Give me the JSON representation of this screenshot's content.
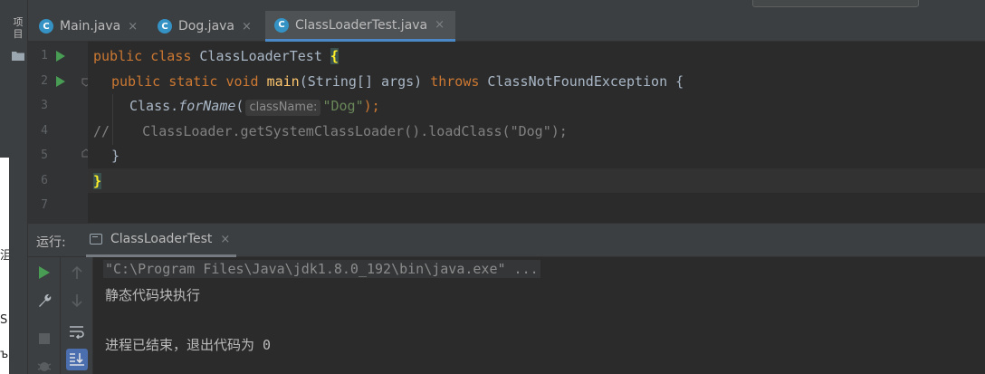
{
  "outside_glyphs": [
    "沮",
    "S",
    "铭",
    "ъ"
  ],
  "sidebar": {
    "project_label": "项目",
    "folder_icon": "folder-icon"
  },
  "tabs": [
    {
      "label": "Main.java",
      "icon": "C",
      "close": "×"
    },
    {
      "label": "Dog.java",
      "icon": "C",
      "close": "×"
    },
    {
      "label": "ClassLoaderTest.java",
      "icon": "C",
      "close": "×",
      "active": true
    }
  ],
  "editor": {
    "line_numbers": [
      "1",
      "2",
      "3",
      "4",
      "5",
      "6",
      "7"
    ],
    "lines": {
      "l1": {
        "kw1": "public",
        "kw2": "class",
        "name": " ClassLoaderTest ",
        "brace": "{"
      },
      "l2": {
        "kw1": "public",
        "kw2": "static",
        "kw3": "void",
        "fn": "main",
        "args": "(String[] args) ",
        "kw4": "throws",
        "rest": " ClassNotFoundException {"
      },
      "l3": {
        "pre": "Class.",
        "method": "forName",
        "open": "(",
        "hint": "className:",
        "str": "\"Dog\"",
        "close": ");"
      },
      "l4": {
        "comment": "//    ClassLoader.getSystemClassLoader().loadClass(\"Dog\");"
      },
      "l5": {
        "text": "}"
      },
      "l6": {
        "brace": "}"
      }
    }
  },
  "run": {
    "label": "运行:",
    "tab_label": "ClassLoaderTest",
    "tab_close": "×",
    "console": [
      "\"C:\\Program Files\\Java\\jdk1.8.0_192\\bin\\java.exe\" ...",
      "静态代码块执行",
      "进程已结束，退出代码为 0"
    ]
  },
  "colors": {
    "accent": "#4a88c7",
    "run_green": "#499c54",
    "keyword": "#cc7832",
    "string": "#6a8759"
  }
}
